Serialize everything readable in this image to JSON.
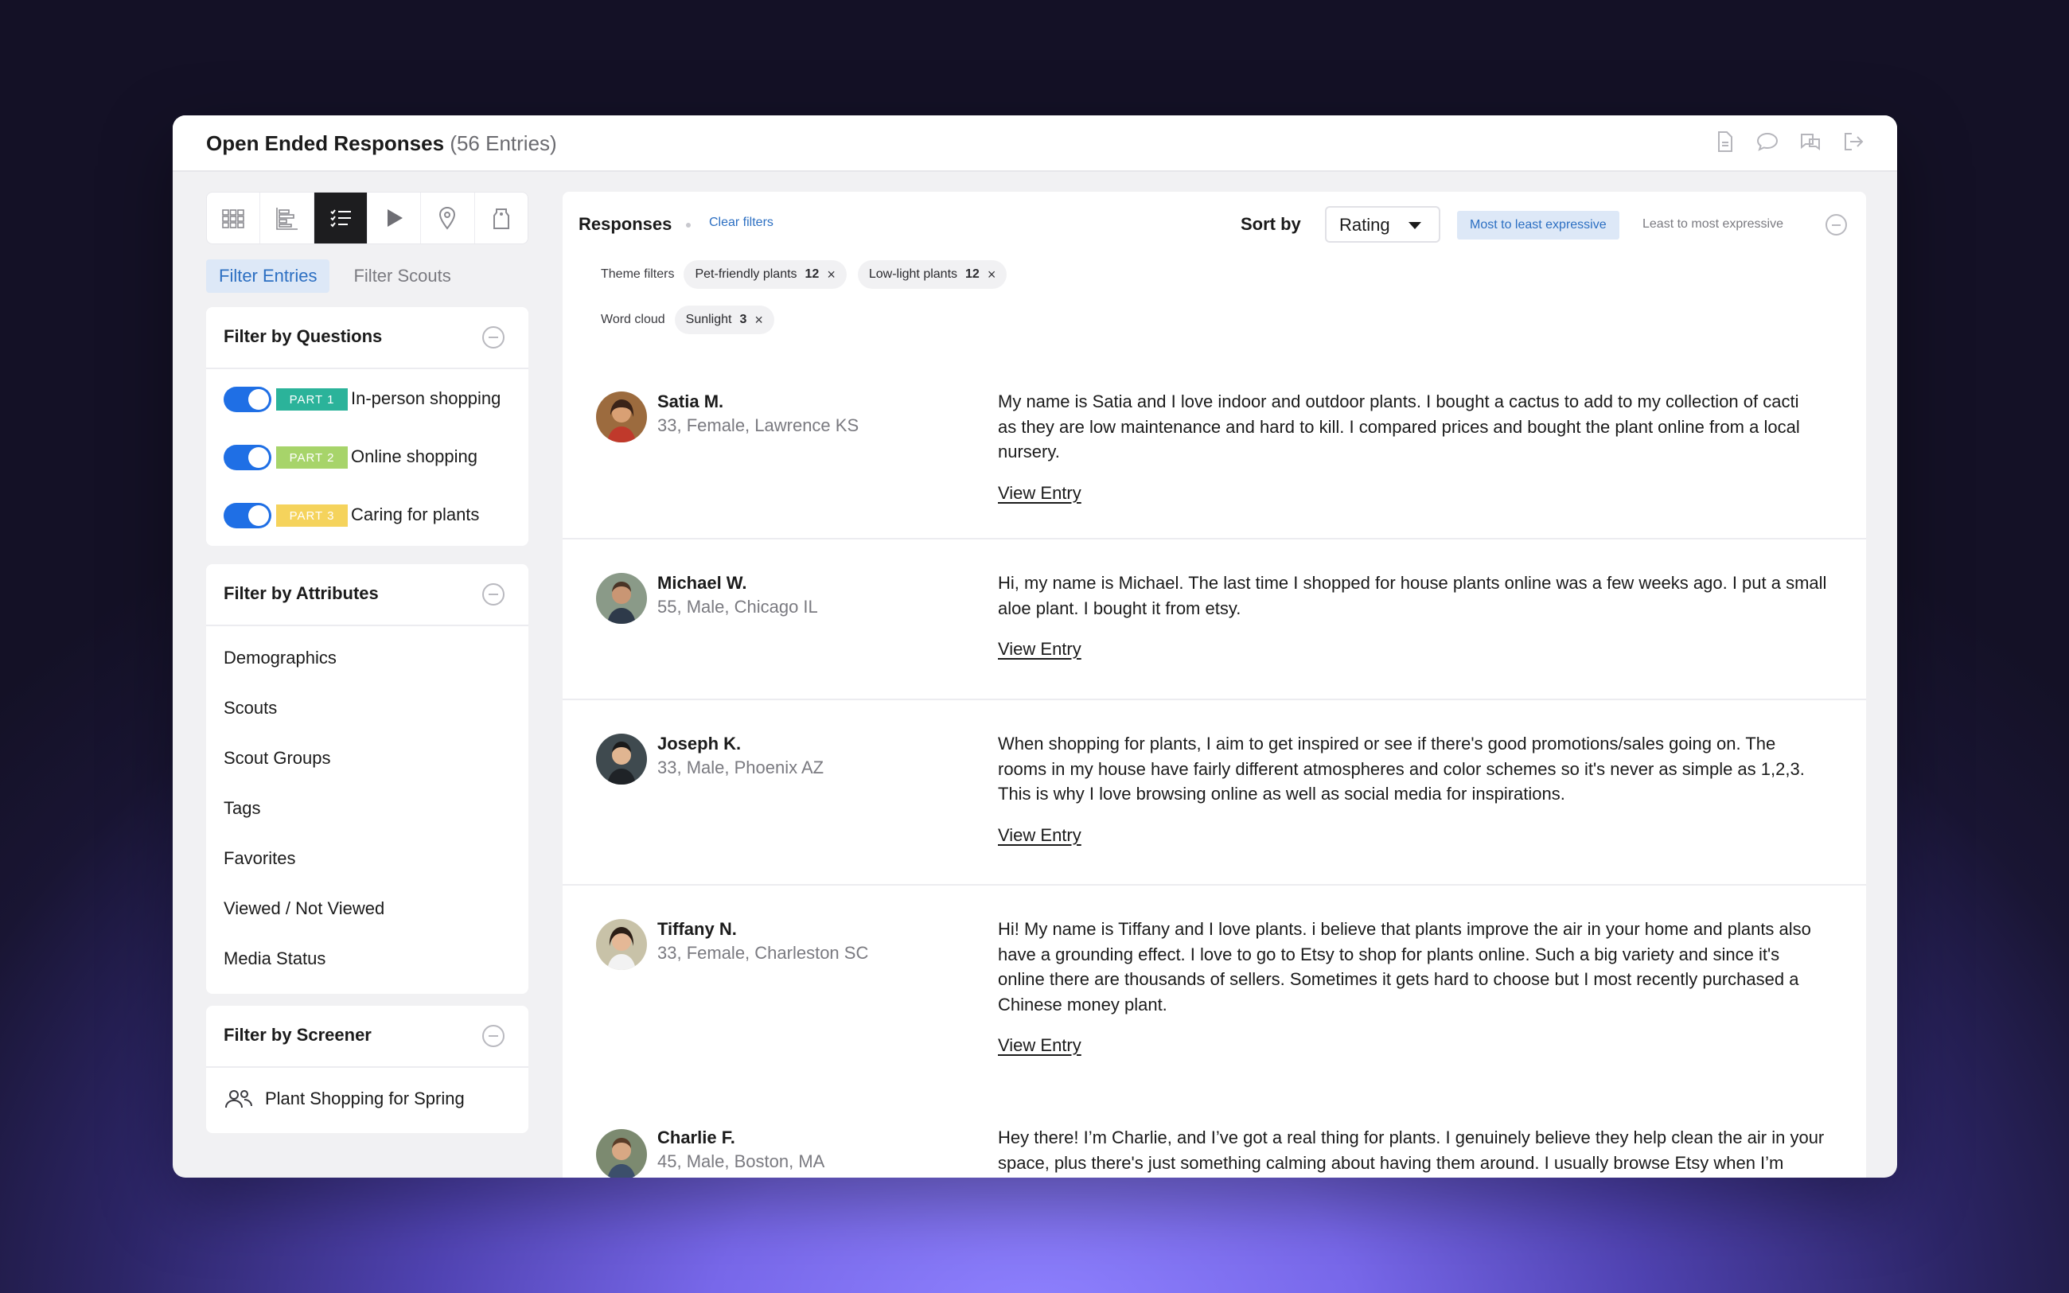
{
  "window": {
    "title": "Open Ended Responses",
    "entry_count": "(56 Entries)"
  },
  "title_icons": [
    "document-icon",
    "comment-icon",
    "translate-icon",
    "logout-icon"
  ],
  "view_toolbar": [
    "grid-view-icon",
    "bar-chart-icon",
    "list-view-icon",
    "play-icon",
    "location-pin-icon",
    "tag-icon"
  ],
  "filter_tabs": {
    "entries": "Filter Entries",
    "scouts": "Filter Scouts"
  },
  "questions_panel": {
    "title": "Filter by Questions",
    "items": [
      {
        "part": "PART 1",
        "label": "In-person shopping",
        "color": "#2bb39a",
        "enabled": true
      },
      {
        "part": "PART 2",
        "label": "Online shopping",
        "color": "#a7d46a",
        "enabled": true
      },
      {
        "part": "PART 3",
        "label": "Caring for plants",
        "color": "#f5d35c",
        "enabled": true
      }
    ]
  },
  "attributes_panel": {
    "title": "Filter by Attributes",
    "items": [
      "Demographics",
      "Scouts",
      "Scout Groups",
      "Tags",
      "Favorites",
      "Viewed / Not Viewed",
      "Media Status"
    ]
  },
  "screener_panel": {
    "title": "Filter by Screener",
    "item": "Plant Shopping for Spring"
  },
  "responses": {
    "title": "Responses",
    "clear_filters": "Clear filters",
    "sort_label": "Sort by",
    "sort_value": "Rating",
    "order_active": "Most to least expressive",
    "order_inactive": "Least to most expressive",
    "theme_filters_label": "Theme filters",
    "theme_filters": [
      {
        "label": "Pet-friendly plants",
        "count": "12"
      },
      {
        "label": "Low-light plants",
        "count": "12"
      }
    ],
    "word_cloud_label": "Word cloud",
    "word_cloud": [
      {
        "label": "Sunlight",
        "count": "3"
      }
    ],
    "view_entry": "View Entry",
    "entries": [
      {
        "name": "Satia M.",
        "meta": "33, Female, Lawrence KS",
        "lines": [
          "My name is Satia and I love indoor and outdoor plants. I bought a cactus to add to my collection of cacti",
          "as they are low maintenance and hard to kill. I compared prices and bought the plant online from a local",
          "nursery."
        ]
      },
      {
        "name": "Michael W.",
        "meta": "55, Male, Chicago IL",
        "lines": [
          "Hi, my name is Michael. The last time I shopped for house plants online was a few weeks ago. I put a small",
          "aloe plant. I bought it from etsy."
        ]
      },
      {
        "name": "Joseph K.",
        "meta": "33, Male, Phoenix AZ",
        "lines": [
          "When shopping for plants, I aim to get inspired or see if there's good promotions/sales going on. The",
          "rooms in my house have fairly different atmospheres and color schemes so it's never as simple as 1,2,3.",
          "This is why I love browsing online as well as social media for inspirations."
        ]
      },
      {
        "name": "Tiffany N.",
        "meta": "33, Female, Charleston SC",
        "lines": [
          "Hi! My name is Tiffany and I love plants. i believe that plants improve the air in your home and plants also",
          "have a grounding effect. I love to go to Etsy to shop for plants online. Such a big variety and since it's",
          "online there are thousands of sellers. Sometimes it gets hard to choose but I most recently purchased a",
          "Chinese money plant."
        ]
      },
      {
        "name": "Charlie F.",
        "meta": "45, Male, Boston, MA",
        "lines": [
          "Hey there! I’m Charlie, and I’ve got a real thing for plants. I genuinely believe they help clean the air in your",
          "space, plus there's just something calming about having them around. I usually browse Etsy when I’m"
        ]
      }
    ]
  }
}
